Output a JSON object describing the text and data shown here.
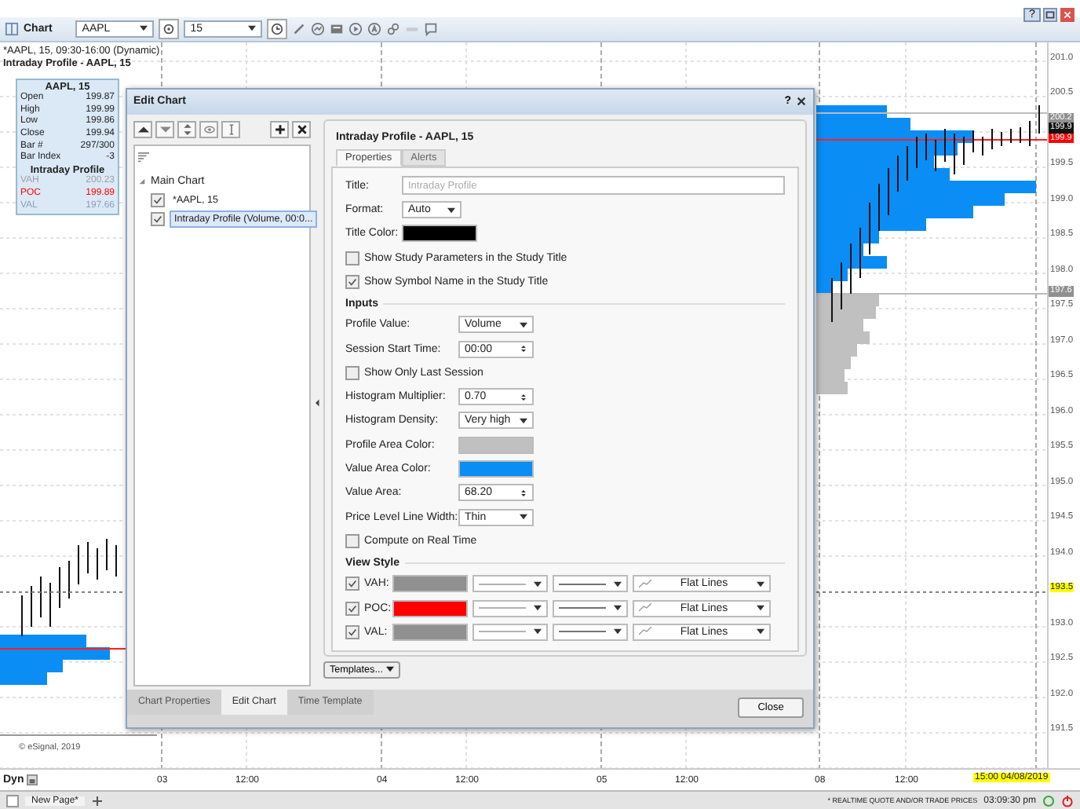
{
  "toolbar": {
    "title": "Chart",
    "symbol": "AAPL",
    "interval": "15",
    "help": "?"
  },
  "chart": {
    "header": "*AAPL, 15, 09:30-16:00 (Dynamic)",
    "study_title": "Intraday Profile - AAPL, 15",
    "copyright": "© eSignal, 2019"
  },
  "data_window": {
    "title": "AAPL, 15",
    "rows": [
      {
        "label": "Open",
        "value": "199.87"
      },
      {
        "label": "High",
        "value": "199.99"
      },
      {
        "label": "Low",
        "value": "199.86"
      },
      {
        "label": "Close",
        "value": "199.94"
      },
      {
        "label": "Bar #",
        "value": "297/300"
      },
      {
        "label": "Bar Index",
        "value": "-3"
      }
    ],
    "section": "Intraday Profile",
    "levels": [
      {
        "label": "VAH",
        "value": "200.23",
        "color": "#a0a0a0"
      },
      {
        "label": "POC",
        "value": "199.89",
        "color": "#ff0000"
      },
      {
        "label": "VAL",
        "value": "197.66",
        "color": "#8aa0b8"
      }
    ]
  },
  "price_axis": {
    "ticks": [
      {
        "label": "201.0",
        "kind": "tick"
      },
      {
        "label": "200.5",
        "kind": "tick"
      },
      {
        "label": "199.5",
        "kind": "tick"
      },
      {
        "label": "199.0",
        "kind": "tick"
      },
      {
        "label": "198.5",
        "kind": "tick"
      },
      {
        "label": "198.0",
        "kind": "tick"
      },
      {
        "label": "197.5",
        "kind": "tick"
      },
      {
        "label": "197.0",
        "kind": "tick"
      },
      {
        "label": "196.5",
        "kind": "tick"
      },
      {
        "label": "196.0",
        "kind": "tick"
      },
      {
        "label": "195.5",
        "kind": "tick"
      },
      {
        "label": "195.0",
        "kind": "tick"
      },
      {
        "label": "194.5",
        "kind": "tick"
      },
      {
        "label": "194.0",
        "kind": "tick"
      },
      {
        "label": "193.5",
        "kind": "crosshair"
      },
      {
        "label": "193.0",
        "kind": "tick"
      },
      {
        "label": "192.5",
        "kind": "tick"
      },
      {
        "label": "192.0",
        "kind": "tick"
      },
      {
        "label": "191.5",
        "kind": "tick"
      }
    ],
    "tags": [
      {
        "label": "200.2",
        "color": "#909090"
      },
      {
        "label": "199.9",
        "color": "#111111"
      },
      {
        "label": "199.9",
        "color": "#ff0000"
      },
      {
        "label": "197.6",
        "color": "#909090"
      }
    ]
  },
  "time_axis": {
    "mode": "Dyn",
    "labels": [
      "03",
      "12:00",
      "04",
      "12:00",
      "05",
      "12:00",
      "08",
      "12:00"
    ],
    "cursor": "15:00 04/08/2019"
  },
  "dialog": {
    "title": "Edit Chart",
    "help": "?",
    "tree": [
      {
        "label": "Main Chart",
        "expanded": true,
        "children": [
          {
            "label": "*AAPL, 15",
            "checked": true,
            "selected": false
          },
          {
            "label": "Intraday Profile (Volume, 00:0...",
            "checked": true,
            "selected": true
          }
        ]
      }
    ],
    "bottom_tabs": [
      {
        "label": "Chart Properties",
        "selected": false
      },
      {
        "label": "Edit Chart",
        "selected": true
      },
      {
        "label": "Time Template",
        "selected": false
      }
    ],
    "study": {
      "heading": "Intraday Profile - AAPL, 15",
      "tabs": [
        {
          "label": "Properties",
          "selected": true
        },
        {
          "label": "Alerts",
          "selected": false
        }
      ],
      "general": [
        {
          "kind": "input",
          "label": "Title:",
          "placeholder": "Intraday Profile"
        },
        {
          "kind": "select",
          "label": "Format:",
          "value": "Auto"
        },
        {
          "kind": "color",
          "label": "Title Color:",
          "color": "#000000"
        },
        {
          "kind": "checkbox",
          "label": "Show Study Parameters in the Study Title",
          "checked": false
        },
        {
          "kind": "checkbox",
          "label": "Show Symbol Name in the Study Title",
          "checked": true
        }
      ],
      "sections": [
        {
          "title": "Inputs",
          "fields": [
            {
              "kind": "select",
              "label": "Profile Value:",
              "value": "Volume"
            },
            {
              "kind": "spin",
              "label": "Session Start Time:",
              "value": "00:00"
            },
            {
              "kind": "checkbox",
              "label": "Show Only Last Session",
              "checked": false
            },
            {
              "kind": "spin",
              "label": "Histogram Multiplier:",
              "value": "0.70"
            },
            {
              "kind": "select",
              "label": "Histogram Density:",
              "value": "Very high"
            },
            {
              "kind": "color",
              "label": "Profile Area Color:",
              "color": "#c0c0c0"
            },
            {
              "kind": "color",
              "label": "Value Area Color:",
              "color": "#0a8df5"
            },
            {
              "kind": "spin",
              "label": "Value Area:",
              "value": "68.20"
            },
            {
              "kind": "select",
              "label": "Price Level Line Width:",
              "value": "Thin"
            },
            {
              "kind": "checkbox",
              "label": "Compute on Real Time",
              "checked": false
            }
          ]
        },
        {
          "title": "View Style",
          "fields": [
            {
              "kind": "style",
              "label": "VAH:",
              "checked": true,
              "color": "#909090",
              "style": "Flat Lines"
            },
            {
              "kind": "style",
              "label": "POC:",
              "checked": true,
              "color": "#ff0000",
              "style": "Flat Lines"
            },
            {
              "kind": "style",
              "label": "VAL:",
              "checked": true,
              "color": "#909090",
              "style": "Flat Lines"
            }
          ]
        }
      ]
    },
    "templates_button": "Templates...",
    "close_button": "Close"
  },
  "status_bar": {
    "checked": false,
    "page": "New Page*",
    "notice": "* REALTIME QUOTE AND/OR TRADE PRICES",
    "time": "03:09:30 pm"
  }
}
